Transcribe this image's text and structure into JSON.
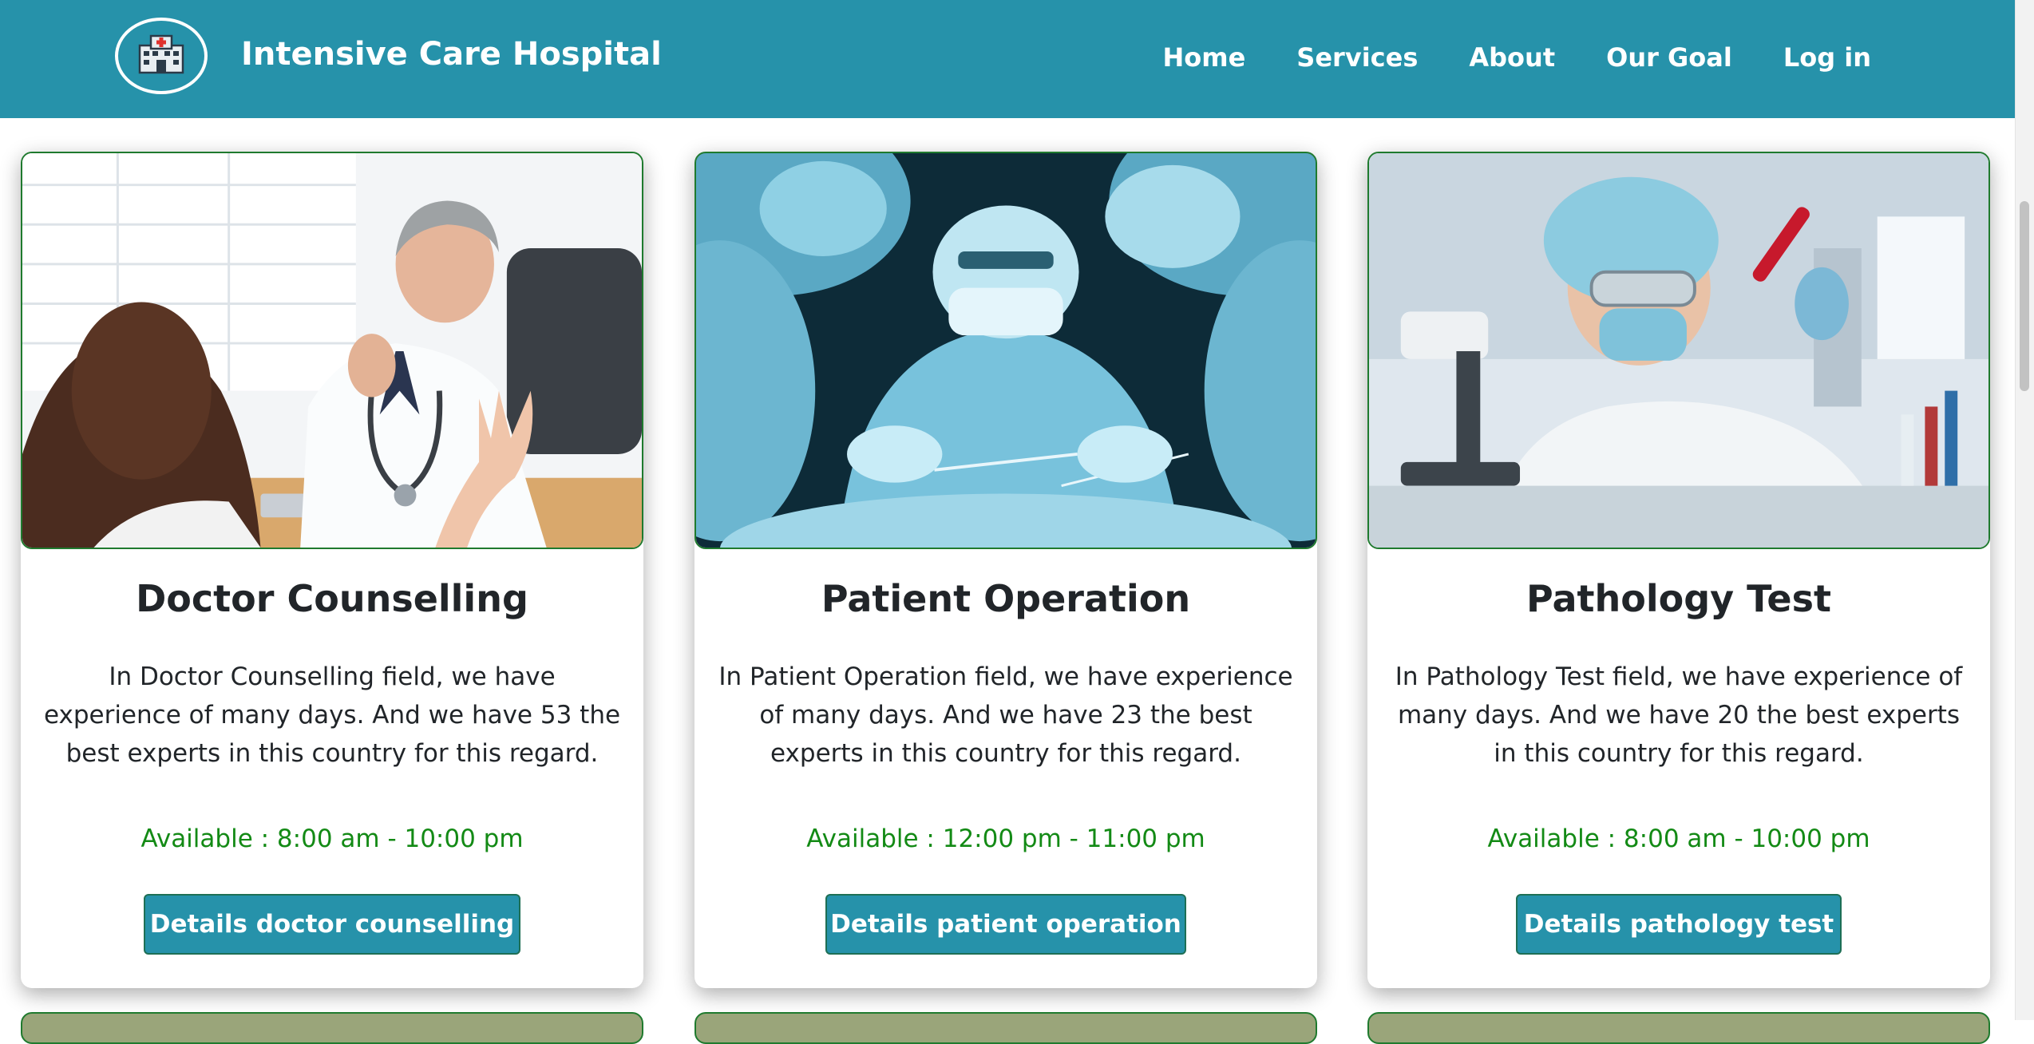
{
  "header": {
    "brand": "Intensive Care Hospital",
    "logo_icon": "hospital-icon",
    "nav": [
      "Home",
      "Services",
      "About",
      "Our Goal",
      "Log in"
    ]
  },
  "colors": {
    "primary": "#2692aa",
    "available_text": "#138a15",
    "image_border": "#1f7a2e"
  },
  "services": [
    {
      "title": "Doctor Counselling",
      "image": "doctor-consultation-photo",
      "description": "In Doctor Counselling field, we have experience of many days. And we have 53 the best experts in this country for this regard.",
      "available": "Available : 8:00 am - 10:00 pm",
      "button": "Details doctor counselling"
    },
    {
      "title": "Patient Operation",
      "image": "surgery-team-photo",
      "description": "In Patient Operation field, we have experience of many days. And we have 23 the best experts in this country for this regard.",
      "available": "Available : 12:00 pm - 11:00 pm",
      "button": "Details patient operation"
    },
    {
      "title": "Pathology Test",
      "image": "lab-scientist-photo",
      "description": "In Pathology Test field, we have experience of many days. And we have 20 the best experts in this country for this regard.",
      "available": "Available : 8:00 am - 10:00 pm",
      "button": "Details pathology test"
    }
  ]
}
